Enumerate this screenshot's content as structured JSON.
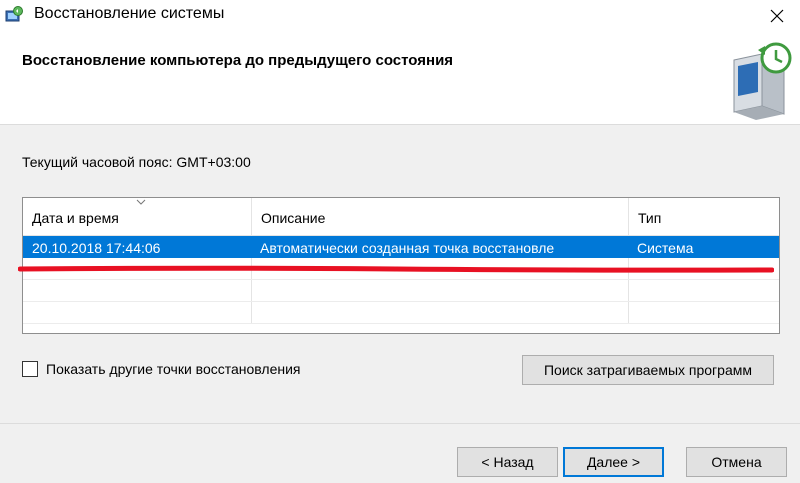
{
  "window": {
    "title": "Восстановление системы",
    "app_icon": "system-restore-icon",
    "close_icon": "close-icon"
  },
  "header": {
    "title": "Восстановление компьютера до предыдущего состояния",
    "icon": "computer-restore-icon"
  },
  "timezone_text": "Текущий часовой пояс: GMT+03:00",
  "restore_points": {
    "columns": [
      "Дата и время",
      "Описание",
      "Тип"
    ],
    "sorted_column": "Дата и время",
    "rows": [
      {
        "datetime": "20.10.2018 17:44:06",
        "description": "Автоматически созданная точка восстановле",
        "type": "Система",
        "selected": true
      }
    ]
  },
  "show_more": {
    "label": "Показать другие точки восстановления",
    "checked": false
  },
  "buttons": {
    "affected_programs": "Поиск затрагиваемых программ",
    "back": "< Назад",
    "next": "Далее >",
    "cancel": "Отмена"
  },
  "colors": {
    "selection": "#0078d7",
    "annotation_underline": "#e81123"
  }
}
